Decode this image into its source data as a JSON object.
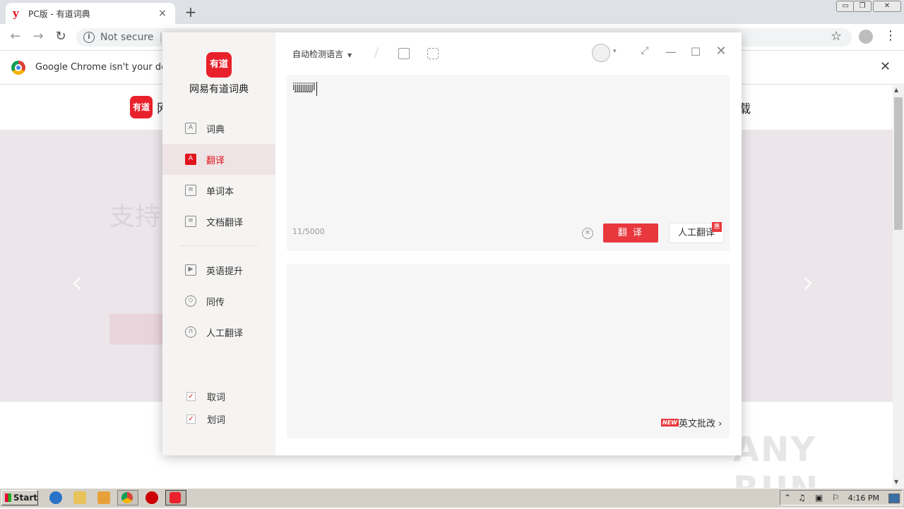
{
  "browser": {
    "tab_title": "PC版 - 有道词典",
    "tab_favicon": "y",
    "tab_close": "×",
    "new_tab": "+",
    "address_security": "Not secure",
    "address_url_fragment": "c",
    "infobar_message": "Google Chrome isn't your default",
    "window_controls": [
      "▭",
      "❐",
      "✕"
    ]
  },
  "page": {
    "logo_text": "有道",
    "brand_partial": "网",
    "download_partial": "载",
    "banner_partial": "支持",
    "watermark": "ANY RUN"
  },
  "app": {
    "logo_text": "有道",
    "name": "网易有道词典",
    "nav": [
      {
        "label": "词典",
        "icon": "dictionary-icon",
        "glyph": "A",
        "active": false
      },
      {
        "label": "翻译",
        "icon": "translate-icon",
        "glyph": "A",
        "active": true
      },
      {
        "label": "单词本",
        "icon": "wordbook-icon",
        "glyph": "≡",
        "active": false
      },
      {
        "label": "文档翻译",
        "icon": "document-icon",
        "glyph": "≡",
        "active": false
      },
      {
        "label": "英语提升",
        "icon": "video-icon",
        "glyph": "▶",
        "active": false
      },
      {
        "label": "同传",
        "icon": "interpretation-icon",
        "glyph": "◇",
        "active": false
      },
      {
        "label": "人工翻译",
        "icon": "headset-icon",
        "glyph": "∩",
        "active": false
      }
    ],
    "checks": [
      {
        "label": "取词",
        "checked": true
      },
      {
        "label": "划词",
        "checked": true
      }
    ],
    "language_selector": "自动检测语言",
    "input_text": "ijjjjjjjjjl",
    "counter": "11/5000",
    "translate_button": "翻 译",
    "human_translate_button": "人工翻译",
    "human_badge": "惠",
    "new_badge": "NEW",
    "essay_link": "英文批改 ›"
  },
  "taskbar": {
    "start": "Start",
    "clock": "4:16 PM"
  },
  "colors": {
    "brand_red": "#e8212b",
    "translate_button": "#e8383d",
    "sidebar_bg": "#f5f4f3",
    "active_nav_bg": "#eee4e5"
  }
}
